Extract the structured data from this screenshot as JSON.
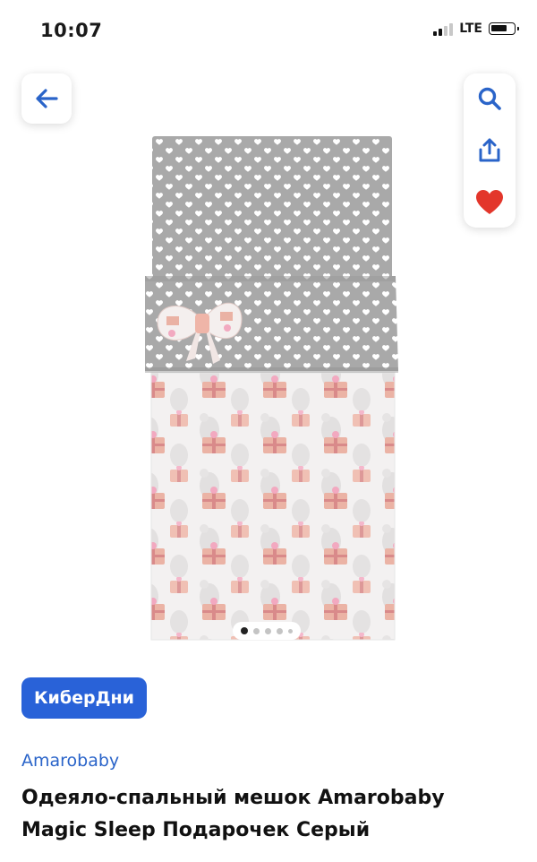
{
  "status": {
    "time": "10:07",
    "network": "LTE",
    "battery_level": 0.75
  },
  "nav": {
    "back_icon": "arrow-left-icon",
    "search_icon": "search-icon",
    "share_icon": "share-icon",
    "favorite_icon": "heart-icon"
  },
  "carousel": {
    "total": 5,
    "active_index": 0
  },
  "product": {
    "promo_badge": "КиберДни",
    "brand": "Amarobaby",
    "title_line1": "Одеяло-спальный мешок Amarobaby",
    "title_line2": "Magic Sleep Подарочек Серый"
  },
  "colors": {
    "accent": "#2962d8",
    "brand_link": "#2a64c9",
    "heart": "#e3362b",
    "icon_blue": "#2a64c9"
  }
}
